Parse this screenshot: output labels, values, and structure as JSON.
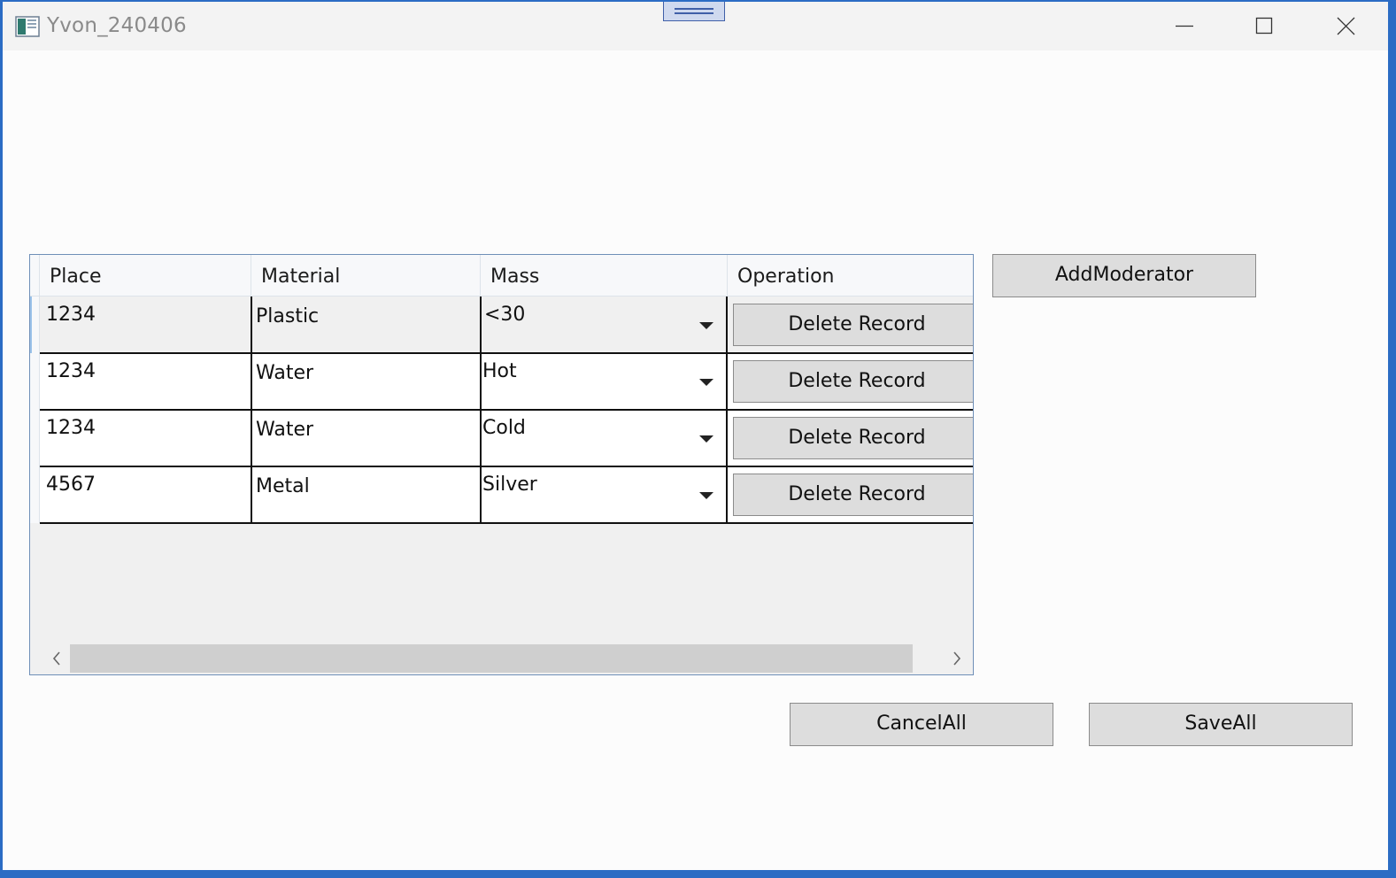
{
  "window": {
    "title": "Yvon_240406",
    "icons": [
      "app-icon",
      "snap-layout-handle",
      "minimize-icon",
      "maximize-icon",
      "close-icon"
    ]
  },
  "grid": {
    "columns": [
      "Place",
      "Material",
      "Mass",
      "Operation"
    ],
    "rows": [
      {
        "place": "1234",
        "material": "Plastic",
        "mass": "<30",
        "operation": "Delete Record"
      },
      {
        "place": "1234",
        "material": "Water",
        "mass": "Hot",
        "operation": "Delete Record"
      },
      {
        "place": "1234",
        "material": "Water",
        "mass": "Cold",
        "operation": "Delete Record"
      },
      {
        "place": "4567",
        "material": "Metal",
        "mass": "Silver",
        "operation": "Delete Record"
      }
    ],
    "scrollbar_icons": [
      "chevron-left-icon",
      "chevron-right-icon"
    ]
  },
  "buttons": {
    "add_moderator": "AddModerator",
    "cancel_all": "CancelAll",
    "save_all": "SaveAll"
  },
  "colors": {
    "desktop_accent": "#2b6cc4",
    "button_face": "#dddddd",
    "grid_background": "#f0f0f0",
    "selected_row": "#f0f0f0"
  }
}
